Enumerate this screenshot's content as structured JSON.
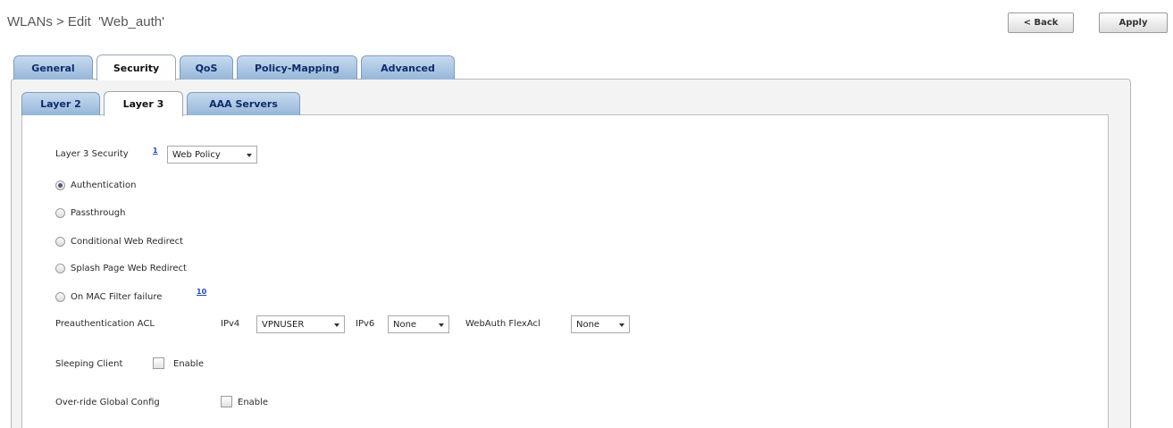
{
  "header": {
    "title": "WLANs > Edit  'Web_auth'",
    "back_label": "< Back",
    "apply_label": "Apply"
  },
  "main_tabs": [
    {
      "label": "General",
      "active": false
    },
    {
      "label": "Security",
      "active": true
    },
    {
      "label": "QoS",
      "active": false
    },
    {
      "label": "Policy-Mapping",
      "active": false
    },
    {
      "label": "Advanced",
      "active": false
    }
  ],
  "sub_tabs": [
    {
      "label": "Layer 2",
      "active": false
    },
    {
      "label": "Layer 3",
      "active": true
    },
    {
      "label": "AAA Servers",
      "active": false
    }
  ],
  "layer3": {
    "security_label": "Layer 3 Security",
    "security_info": "1",
    "security_value": "Web Policy",
    "radios": [
      {
        "label": "Authentication",
        "checked": true
      },
      {
        "label": "Passthrough",
        "checked": false
      },
      {
        "label": "Conditional Web Redirect",
        "checked": false
      },
      {
        "label": "Splash Page Web Redirect",
        "checked": false
      },
      {
        "label": "On MAC Filter failure",
        "checked": false,
        "info": "10"
      }
    ],
    "preauth": {
      "label": "Preauthentication ACL",
      "ipv4_label": "IPv4",
      "ipv4_value": "VPNUSER",
      "ipv6_label": "IPv6",
      "ipv6_value": "None",
      "flexacl_label": "WebAuth FlexAcl",
      "flexacl_value": "None"
    },
    "sleeping_client": {
      "label": "Sleeping Client",
      "enable_label": "Enable",
      "checked": false
    },
    "override_global": {
      "label": "Over-ride Global Config",
      "enable_label": "Enable",
      "checked": false
    }
  }
}
